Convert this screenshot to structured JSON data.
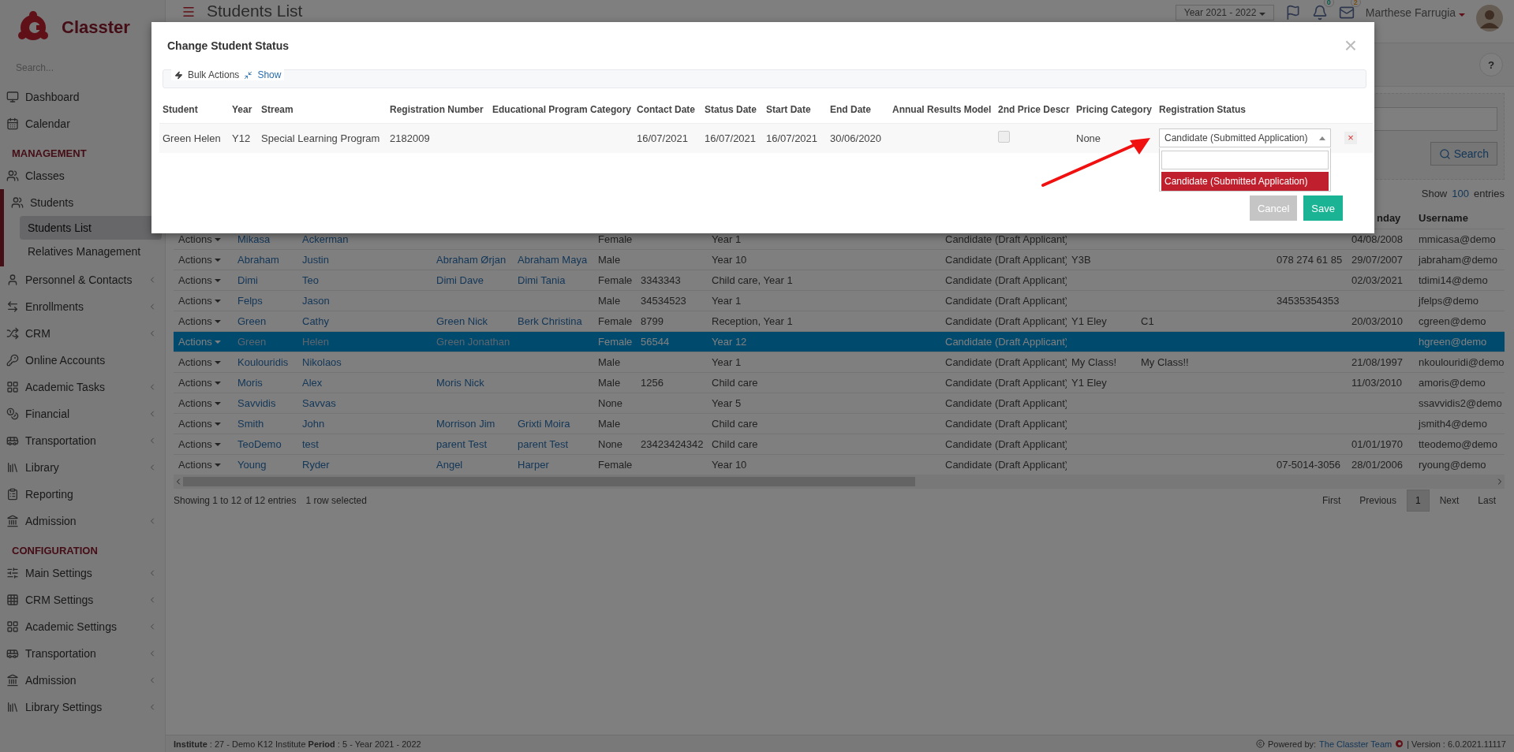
{
  "app": {
    "logo_text": "Classter",
    "search_placeholder": "Search..."
  },
  "sidebar": {
    "items": [
      {
        "kind": "item",
        "label": "Dashboard"
      },
      {
        "kind": "item",
        "label": "Calendar"
      },
      {
        "kind": "section",
        "label": "MANAGEMENT"
      },
      {
        "kind": "item",
        "label": "Classes"
      },
      {
        "kind": "item",
        "label": "Students",
        "expanded": true,
        "children": [
          {
            "label": "Students List",
            "selected": true
          },
          {
            "label": "Relatives Management",
            "selected": false
          }
        ]
      },
      {
        "kind": "item",
        "label": "Personnel & Contacts",
        "submenu": true
      },
      {
        "kind": "item",
        "label": "Enrollments",
        "submenu": true
      },
      {
        "kind": "item",
        "label": "CRM",
        "submenu": true
      },
      {
        "kind": "item",
        "label": "Online Accounts",
        "submenu": false
      },
      {
        "kind": "item",
        "label": "Academic Tasks",
        "submenu": true
      },
      {
        "kind": "item",
        "label": "Financial",
        "submenu": true
      },
      {
        "kind": "item",
        "label": "Transportation",
        "submenu": true
      },
      {
        "kind": "item",
        "label": "Library",
        "submenu": true
      },
      {
        "kind": "item",
        "label": "Reporting",
        "submenu": false
      },
      {
        "kind": "item",
        "label": "Admission",
        "submenu": true
      },
      {
        "kind": "section",
        "label": "CONFIGURATION"
      },
      {
        "kind": "item",
        "label": "Main Settings",
        "submenu": true
      },
      {
        "kind": "item",
        "label": "CRM Settings",
        "submenu": true
      },
      {
        "kind": "item",
        "label": "Academic Settings",
        "submenu": true
      },
      {
        "kind": "item",
        "label": "Transportation",
        "submenu": true
      },
      {
        "kind": "item",
        "label": "Admission",
        "submenu": true
      },
      {
        "kind": "item",
        "label": "Library Settings",
        "submenu": true
      }
    ]
  },
  "topbar": {
    "page_title": "Students List",
    "year_select": "Year 2021 - 2022",
    "notifications_count": "0",
    "messages_count": "2",
    "user_name": "Marthese Farrugia",
    "help": "?"
  },
  "filter": {
    "search_button": "Search"
  },
  "table": {
    "show_label": "Show",
    "page_size": "100",
    "entries_label": "entries",
    "header_visible": [
      "nday",
      "Username"
    ],
    "rows": [
      {
        "selected": false,
        "column_1": "Actions",
        "column_2": "Mikasa",
        "column_3": "Ackerman",
        "column_6": "Female",
        "column_8": "Year 1",
        "column_9": "Candidate (Draft Applicant)",
        "column_13": "04/08/2008",
        "column_14": "mmicasa@demo"
      },
      {
        "selected": false,
        "column_1": "Actions",
        "column_2": "Abraham",
        "column_3": "Justin",
        "column_4": "Abraham Ørjan",
        "column_5": "Abraham Maya",
        "column_6": "Male",
        "column_8": "Year 10",
        "column_9": "Candidate (Draft Applicant)",
        "column_10": "Y3B",
        "column_12": "078 274 61 85",
        "column_13": "29/07/2007",
        "column_14": "jabraham@demo"
      },
      {
        "selected": false,
        "column_1": "Actions",
        "column_2": "Dimi",
        "column_3": "Teo",
        "column_4": "Dimi Dave",
        "column_5": "Dimi Tania",
        "column_6": "Female",
        "column_7": "3343343",
        "column_8": "Child care, Year 1",
        "column_9": "Candidate (Draft Applicant)",
        "column_13": "02/03/2021",
        "column_14": "tdimi14@demo"
      },
      {
        "selected": false,
        "column_1": "Actions",
        "column_2": "Felps",
        "column_3": "Jason",
        "column_6": "Male",
        "column_7": "34534523",
        "column_8": "Year 1",
        "column_9": "Candidate (Draft Applicant)",
        "column_12": "34535354353",
        "column_14": "jfelps@demo"
      },
      {
        "selected": false,
        "column_1": "Actions",
        "column_2": "Green",
        "column_3": "Cathy",
        "column_4": "Green Nick",
        "column_5": "Berk Christina",
        "column_6": "Female",
        "column_7": "8799",
        "column_8": "Reception, Year 1",
        "column_9": "Candidate (Draft Applicant)",
        "column_10": "Y1 Eley",
        "column_11": "C1",
        "column_13": "20/03/2010",
        "column_14": "cgreen@demo"
      },
      {
        "selected": true,
        "column_1": "Actions",
        "column_2": "Green",
        "column_3": "Helen",
        "column_4": "Green Jonathan",
        "column_6": "Female",
        "column_7": "56544",
        "column_8": "Year 12",
        "column_9": "Candidate (Draft Applicant)",
        "column_14": "hgreen@demo"
      },
      {
        "selected": false,
        "column_1": "Actions",
        "column_2": "Koulouridis",
        "column_3": "Nikolaos",
        "column_6": "Male",
        "column_8": "Year 1",
        "column_9": "Candidate (Draft Applicant)",
        "column_10": "My Class!",
        "column_11": "My Class!!",
        "column_13": "21/08/1997",
        "column_14": "nkoulouridi@demo"
      },
      {
        "selected": false,
        "column_1": "Actions",
        "column_2": "Moris",
        "column_3": "Alex",
        "column_4": "Moris Nick",
        "column_6": "Male",
        "column_7": "1256",
        "column_8": "Child care",
        "column_9": "Candidate (Draft Applicant)",
        "column_10": "Y1 Eley",
        "column_13": "11/03/2010",
        "column_14": "amoris@demo"
      },
      {
        "selected": false,
        "column_1": "Actions",
        "column_2": "Savvidis",
        "column_3": "Savvas",
        "column_6": "None",
        "column_8": "Year 5",
        "column_9": "Candidate (Draft Applicant)",
        "column_14": "ssavvidis2@demo"
      },
      {
        "selected": false,
        "column_1": "Actions",
        "column_2": "Smith",
        "column_3": "John",
        "column_4": "Morrison Jim",
        "column_5": "Grixti Moira",
        "column_6": "Male",
        "column_8": "Child care",
        "column_9": "Candidate (Draft Applicant)",
        "column_14": "jsmith4@demo"
      },
      {
        "selected": false,
        "column_1": "Actions",
        "column_2": "TeoDemo",
        "column_3": "test",
        "column_4": "parent Test",
        "column_5": "parent Test",
        "column_6": "None",
        "column_7": "23423424342",
        "column_8": "Child care",
        "column_9": "Candidate (Draft Applicant)",
        "column_13": "01/01/1970",
        "column_14": "tteodemo@demo"
      },
      {
        "selected": false,
        "column_1": "Actions",
        "column_2": "Young",
        "column_3": "Ryder",
        "column_4": "Angel",
        "column_5": "Harper",
        "column_6": "Female",
        "column_8": "Year 10",
        "column_9": "Candidate (Draft Applicant)",
        "column_12": "07-5014-3056",
        "column_13": "28/01/2006",
        "column_14": "ryoung@demo"
      }
    ]
  },
  "table_info": {
    "summary": "Showing 1 to 12 of 12 entries",
    "selection": "1 row selected"
  },
  "pagination": [
    {
      "label": "First",
      "selected": false
    },
    {
      "label": "Previous",
      "selected": false
    },
    {
      "label": "1",
      "selected": true
    },
    {
      "label": "Next",
      "selected": false
    },
    {
      "label": "Last",
      "selected": false
    }
  ],
  "footer": {
    "left": "**Institute** : 27 - Demo K12 Institute **Period** : 5 - Year 2021 - 2022",
    "powered_by": "Powered by:",
    "team_link": "The Classter Team",
    "version": "| Version : 6.0.2021.11117"
  },
  "modal": {
    "title": "Change Student Status",
    "close": "×",
    "bulk_actions": "Bulk Actions",
    "show_link": "Show",
    "columns": [
      "Student",
      "Year",
      "Stream",
      "Registration Number",
      "Educational Program Category",
      "Contact Date",
      "Status Date",
      "Start Date",
      "End Date",
      "Annual Results Model",
      "2nd Price Descr",
      "Pricing Category",
      "Registration Status"
    ],
    "row": {
      "student": "Green Helen",
      "year": "Y12",
      "stream": "Special Learning Program",
      "registration_number": "2182009",
      "contact_date": "16/07/2021",
      "status_date": "16/07/2021",
      "start_date": "16/07/2021",
      "end_date": "30/06/2020",
      "second_price_checked": false,
      "pricing_category": "None",
      "registration_status": {
        "value": "Candidate (Submitted Application)",
        "expanded": true,
        "options": [
          {
            "label": "Candidate (Submitted Application)",
            "selected": true
          }
        ]
      },
      "remove": "×"
    },
    "cancel": "Cancel",
    "save": "Save"
  }
}
